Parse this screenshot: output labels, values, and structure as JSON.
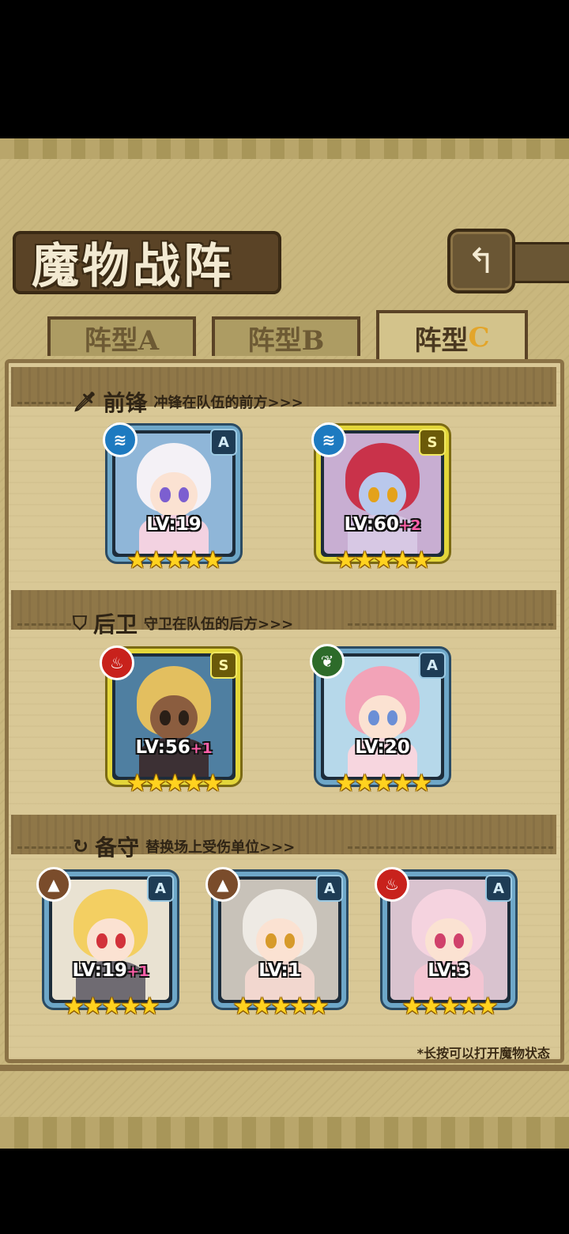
{
  "title": "魔物战阵",
  "back_icon": "back-arrow-icon",
  "tabs": [
    {
      "label": "阵型A",
      "active": false
    },
    {
      "label": "阵型B",
      "active": false
    },
    {
      "label": "阵型",
      "letter": "C",
      "active": true
    }
  ],
  "sections": {
    "front": {
      "name": "前锋",
      "desc": "冲锋在队伍的前方>>>",
      "icon": "sword-icon"
    },
    "rear": {
      "name": "后卫",
      "desc": "守卫在队伍的后方>>>",
      "icon": "shield-icon"
    },
    "reserve": {
      "name": "备守",
      "desc": "替换场上受伤单位>>>",
      "icon": "swap-icon"
    }
  },
  "cards": [
    {
      "rank": "A",
      "element": "water",
      "lv": "LV:19",
      "plus": "",
      "stars": "★★★★★"
    },
    {
      "rank": "S",
      "element": "water",
      "lv": "LV:60",
      "plus": "+2",
      "stars": "★★★★★"
    },
    {
      "rank": "S",
      "element": "fire",
      "lv": "LV:56",
      "plus": "+1",
      "stars": "★★★★★"
    },
    {
      "rank": "A",
      "element": "grass",
      "lv": "LV:20",
      "plus": "",
      "stars": "★★★★★"
    },
    {
      "rank": "A",
      "element": "earth",
      "lv": "LV:19",
      "plus": "+1",
      "stars": "★★★★★"
    },
    {
      "rank": "A",
      "element": "earth",
      "lv": "LV:1",
      "plus": "",
      "stars": "★★★★★"
    },
    {
      "rank": "A",
      "element": "fire",
      "lv": "LV:3",
      "plus": "",
      "stars": "★★★★★"
    }
  ],
  "hint": "*长按可以打开魔物状态",
  "colors": {
    "rank_a_border": "#6ea7c8",
    "rank_s_border": "#e3d63a",
    "parchment": "#d9c896"
  }
}
